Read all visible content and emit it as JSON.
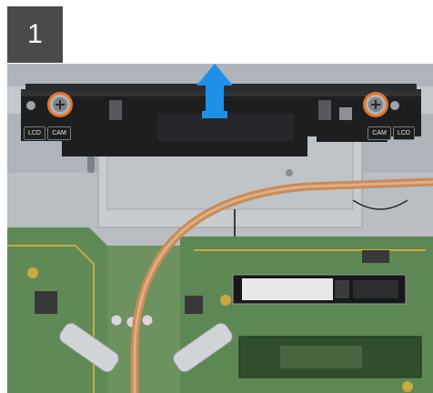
{
  "step": {
    "number": "1"
  },
  "bracket_labels": {
    "left": [
      "LCD",
      "CAM"
    ],
    "right": [
      "CAM",
      "LCD"
    ]
  },
  "icons": {
    "arrow": "arrow-up-icon",
    "screw": "screw-icon"
  },
  "colors": {
    "step_badge": "#4a4a4a",
    "arrow": "#1e90e8",
    "screw_highlight": "#e8742a",
    "copper": "#c88b5a",
    "pcb": "#5f8a55"
  }
}
